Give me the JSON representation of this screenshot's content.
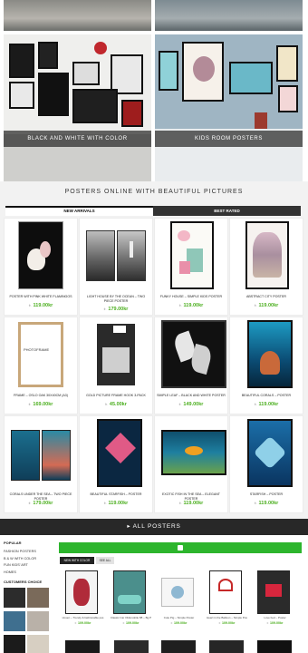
{
  "hero": {
    "left_caption": "BLACK AND WHITE WITH COLOR",
    "right_caption": "KIDS ROOM POSTERS"
  },
  "section": {
    "title": "POSTERS ONLINE WITH BEAUTIFUL PICTURES",
    "tabs": [
      {
        "label": "NEW ARRIVALS",
        "active": true
      },
      {
        "label": "BEST RATED",
        "active": false
      }
    ]
  },
  "products": [
    {
      "name": "POSTER WITH PINK WHITE FLAMINGOS",
      "price_prefix": "fr.",
      "price": "119.00kr",
      "image": "flamingos"
    },
    {
      "name": "LIGHT HOUSE BY THE OCEAN – TWO PIECE POSTER",
      "price_prefix": "fr.",
      "price": "179.00kr",
      "image": "lighthouse"
    },
    {
      "name": "FUNKY HOUSE – SIMPLE KIDS POSTER",
      "price_prefix": "fr.",
      "price": "119.00kr",
      "image": "funky-house"
    },
    {
      "name": "ABSTRACT CITY POSTER",
      "price_prefix": "fr.",
      "price": "119.00kr",
      "image": "city"
    },
    {
      "name": "FRAME – OSLO OAK 30X40CM (A3)",
      "price_prefix": "fr.",
      "price": "169.00kr",
      "image": "frame"
    },
    {
      "name": "GOLD PICTURE FRAME HOOK 3-PACK",
      "price_prefix": "fr.",
      "price": "45.00kr",
      "image": "hooks"
    },
    {
      "name": "SIMPLE LEAF – BLACK AND WHITE POSTER",
      "price_prefix": "fr.",
      "price": "149.00kr",
      "image": "leaf"
    },
    {
      "name": "BEAUTIFUL CORALS – POSTER",
      "price_prefix": "fr.",
      "price": "119.00kr",
      "image": "corals"
    },
    {
      "name": "CORALS UNDER THE SEA – TWO PIECE POSTER",
      "price_prefix": "fr.",
      "price": "179.00kr",
      "image": "corals-two"
    },
    {
      "name": "BEAUTIFUL STARFISH – POSTER",
      "price_prefix": "fr.",
      "price": "119.00kr",
      "image": "starfish"
    },
    {
      "name": "EXOTIC FISH IN THE SEA – ELEGANT POSTER",
      "price_prefix": "fr.",
      "price": "119.00kr",
      "image": "fish"
    },
    {
      "name": "STARFISH – POSTER",
      "price_prefix": "fr.",
      "price": "119.00kr",
      "image": "starfish-blue"
    }
  ],
  "all_posters_button": "▸ ALL POSTERS",
  "sidebar": {
    "title": "POPULAR",
    "items": [
      "FASHION POSTERS",
      "B & W WITH COLOR",
      "FUN KIDS' ART",
      "HOMES"
    ],
    "customers_choice": "CUSTOMERS CHOICE"
  },
  "filter_bar_icon": "grid-icon",
  "mini_tabs": [
    {
      "label": "NEW WITH COLOR",
      "active": true
    },
    {
      "label": "SEE ALL",
      "active": false
    }
  ],
  "mini_products": [
    {
      "name": "Hi-sen – Trendy & fashionable pos",
      "price_prefix": "fr.",
      "price": "109.00kr"
    },
    {
      "name": "Classic Car Oldsmobile 88 – Bg P",
      "price_prefix": "fr.",
      "price": "109.00kr"
    },
    {
      "name": "Cute Pig – Simple Poster",
      "price_prefix": "fr.",
      "price": "109.00kr"
    },
    {
      "name": "Heart in the Balloon – Simple Pos",
      "price_prefix": "fr.",
      "price": "109.00kr"
    },
    {
      "name": "Love bed – Poster",
      "price_prefix": "fr.",
      "price": "109.00kr"
    }
  ],
  "colors": {
    "accent_green": "#2db52d",
    "price_green": "#4caf1f",
    "dark": "#282828"
  }
}
